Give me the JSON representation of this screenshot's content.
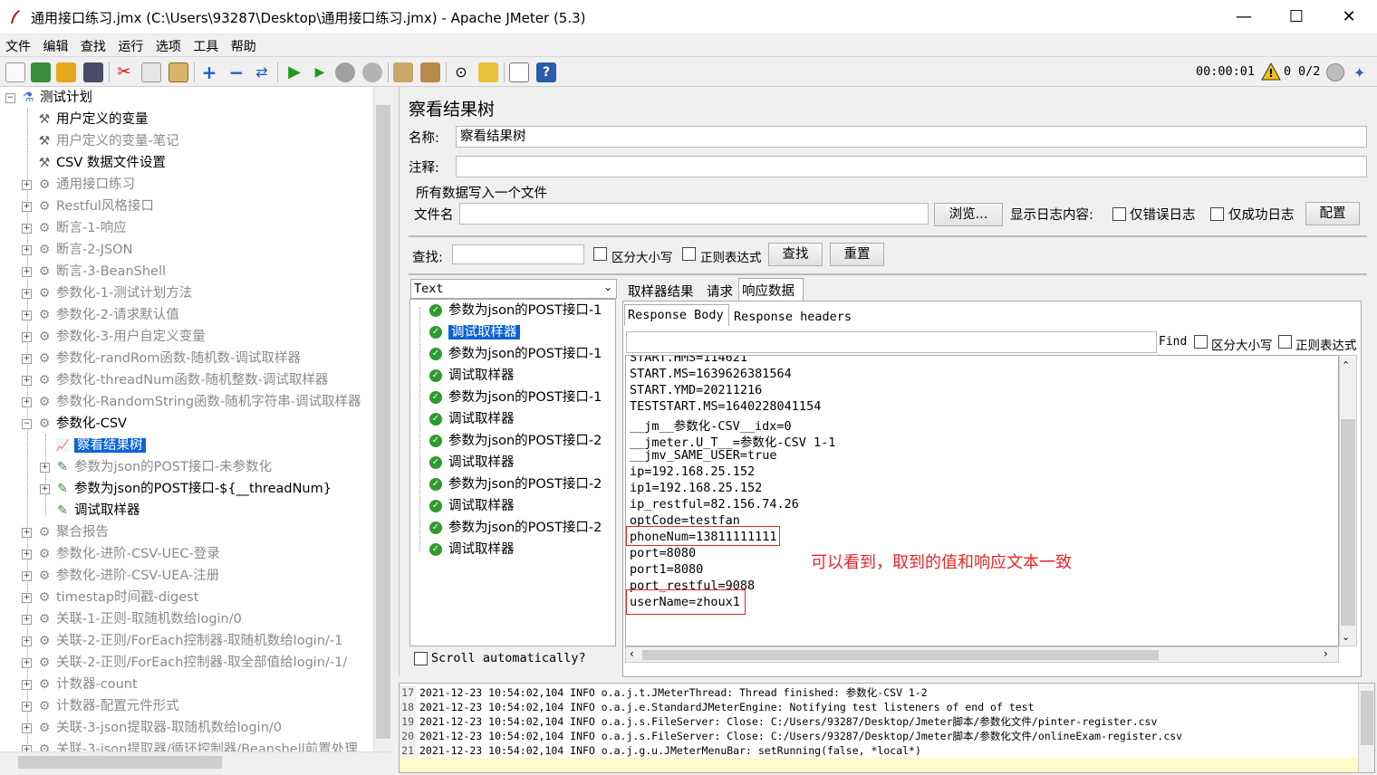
{
  "window": {
    "title": "通用接口练习.jmx (C:\\Users\\93287\\Desktop\\通用接口练习.jmx) - Apache JMeter (5.3)",
    "minimize": "—",
    "maximize": "☐",
    "close": "✕"
  },
  "menu": [
    "文件",
    "编辑",
    "查找",
    "运行",
    "选项",
    "工具",
    "帮助"
  ],
  "status": {
    "elapsed": "00:00:01",
    "warnings": "0",
    "threads": "0/2"
  },
  "tree": {
    "root": "测试计划",
    "items": [
      {
        "label": "用户定义的变量",
        "icon": "wrench-icon",
        "disabled": false
      },
      {
        "label": "用户定义的变量-笔记",
        "icon": "wrench-icon",
        "disabled": true
      },
      {
        "label": "CSV 数据文件设置",
        "icon": "wrench-icon",
        "disabled": false
      },
      {
        "label": "通用接口练习",
        "icon": "gear-icon",
        "disabled": true
      },
      {
        "label": "Restful风格接口",
        "icon": "gear-icon",
        "disabled": true
      },
      {
        "label": "断言-1-响应",
        "icon": "gear-icon",
        "disabled": true
      },
      {
        "label": "断言-2-JSON",
        "icon": "gear-icon",
        "disabled": true
      },
      {
        "label": "断言-3-BeanShell",
        "icon": "gear-icon",
        "disabled": true
      },
      {
        "label": "参数化-1-测试计划方法",
        "icon": "gear-icon",
        "disabled": true
      },
      {
        "label": "参数化-2-请求默认值",
        "icon": "gear-icon",
        "disabled": true
      },
      {
        "label": "参数化-3-用户自定义变量",
        "icon": "gear-icon",
        "disabled": true
      },
      {
        "label": "参数化-randRom函数-随机数-调试取样器",
        "icon": "gear-icon",
        "disabled": true
      },
      {
        "label": "参数化-threadNum函数-随机整数-调试取样器",
        "icon": "gear-icon",
        "disabled": true
      },
      {
        "label": "参数化-RandomString函数-随机字符串-调试取样器",
        "icon": "gear-icon",
        "disabled": true
      },
      {
        "label": "参数化-CSV",
        "icon": "gear-icon",
        "disabled": false
      },
      {
        "label": "察看结果树",
        "icon": "chart-icon",
        "disabled": false,
        "selected": true
      },
      {
        "label": "参数为json的POST接口-未参数化",
        "icon": "pipette-icon",
        "disabled": true
      },
      {
        "label": "参数为json的POST接口-${__threadNum}",
        "icon": "pipette-icon",
        "disabled": false
      },
      {
        "label": "调试取样器",
        "icon": "pipette-icon",
        "disabled": false
      },
      {
        "label": "聚合报告",
        "icon": "gear-icon",
        "disabled": true
      },
      {
        "label": "参数化-进阶-CSV-UEC-登录",
        "icon": "gear-icon",
        "disabled": true
      },
      {
        "label": "参数化-进阶-CSV-UEA-注册",
        "icon": "gear-icon",
        "disabled": true
      },
      {
        "label": "timestap时间戳-digest",
        "icon": "gear-icon",
        "disabled": true
      },
      {
        "label": "关联-1-正则-取随机数给login/0",
        "icon": "gear-icon",
        "disabled": true
      },
      {
        "label": "关联-2-正则/ForEach控制器-取随机数给login/-1",
        "icon": "gear-icon",
        "disabled": true
      },
      {
        "label": "关联-2-正则/ForEach控制器-取全部值给login/-1/",
        "icon": "gear-icon",
        "disabled": true
      },
      {
        "label": "计数器-count",
        "icon": "gear-icon",
        "disabled": true
      },
      {
        "label": "计数器-配置元件形式",
        "icon": "gear-icon",
        "disabled": true
      },
      {
        "label": "关联-3-json提取器-取随机数给login/0",
        "icon": "gear-icon",
        "disabled": true
      },
      {
        "label": "关联-3-json提取器/循环控制器/Beanshell前置处理",
        "icon": "gear-icon",
        "disabled": true
      }
    ]
  },
  "panel": {
    "heading": "察看结果树",
    "name_label": "名称:",
    "name_value": "察看结果树",
    "comment_label": "注释:",
    "comment_value": "",
    "file_group": "所有数据写入一个文件",
    "file_label": "文件名",
    "file_value": "",
    "browse": "浏览...",
    "log_label": "显示日志内容:",
    "errors_only": "仅错误日志",
    "success_only": "仅成功日志",
    "configure": "配置",
    "search_label": "查找:",
    "case_sensitive": "区分大小写",
    "regex": "正则表达式",
    "find_btn": "查找",
    "reset_btn": "重置",
    "renderer": "Text",
    "results": [
      "参数为json的POST接口-1",
      "调试取样器",
      "参数为json的POST接口-1",
      "调试取样器",
      "参数为json的POST接口-1",
      "调试取样器",
      "参数为json的POST接口-2",
      "调试取样器",
      "参数为json的POST接口-2",
      "调试取样器",
      "参数为json的POST接口-2",
      "调试取样器"
    ],
    "scroll_auto": "Scroll automatically?",
    "tabs": [
      "取样器结果",
      "请求",
      "响应数据"
    ],
    "subtabs": [
      "Response Body",
      "Response headers"
    ],
    "find_label": "Find",
    "find_case": "区分大小写",
    "find_regex": "正则表达式",
    "response_lines": [
      "START.HMS=114621",
      "START.MS=1639626381564",
      "START.YMD=20211216",
      "TESTSTART.MS=1640228041154",
      "__jm__参数化-CSV__idx=0",
      "__jmeter.U_T__=参数化-CSV 1-1",
      "__jmv_SAME_USER=true",
      "ip=192.168.25.152",
      "ip1=192.168.25.152",
      "ip_restful=82.156.74.26",
      "optCode=testfan",
      "phoneNum=13811111111",
      "port=8080",
      "port1=8080",
      "port_restful=9088",
      "userName=zhoux1"
    ],
    "annotation": "可以看到，取到的值和响应文本一致"
  },
  "log": [
    {
      "n": "17",
      "text": "2021-12-23 10:54:02,104 INFO o.a.j.t.JMeterThread: Thread finished: 参数化-CSV 1-2"
    },
    {
      "n": "18",
      "text": "2021-12-23 10:54:02,104 INFO o.a.j.e.StandardJMeterEngine: Notifying test listeners of end of test"
    },
    {
      "n": "19",
      "text": "2021-12-23 10:54:02,104 INFO o.a.j.s.FileServer: Close: C:/Users/93287/Desktop/Jmeter脚本/参数化文件/pinter-register.csv"
    },
    {
      "n": "20",
      "text": "2021-12-23 10:54:02,104 INFO o.a.j.s.FileServer: Close: C:/Users/93287/Desktop/Jmeter脚本/参数化文件/onlineExam-register.csv"
    },
    {
      "n": "21",
      "text": "2021-12-23 10:54:02,104 INFO o.a.j.g.u.JMeterMenuBar: setRunning(false, *local*)"
    }
  ],
  "colors": {
    "selection": "#0a64d8",
    "annotation": "#e8252a",
    "highlight_box": "#e8252a",
    "log_current_line": "#fffbc8"
  }
}
